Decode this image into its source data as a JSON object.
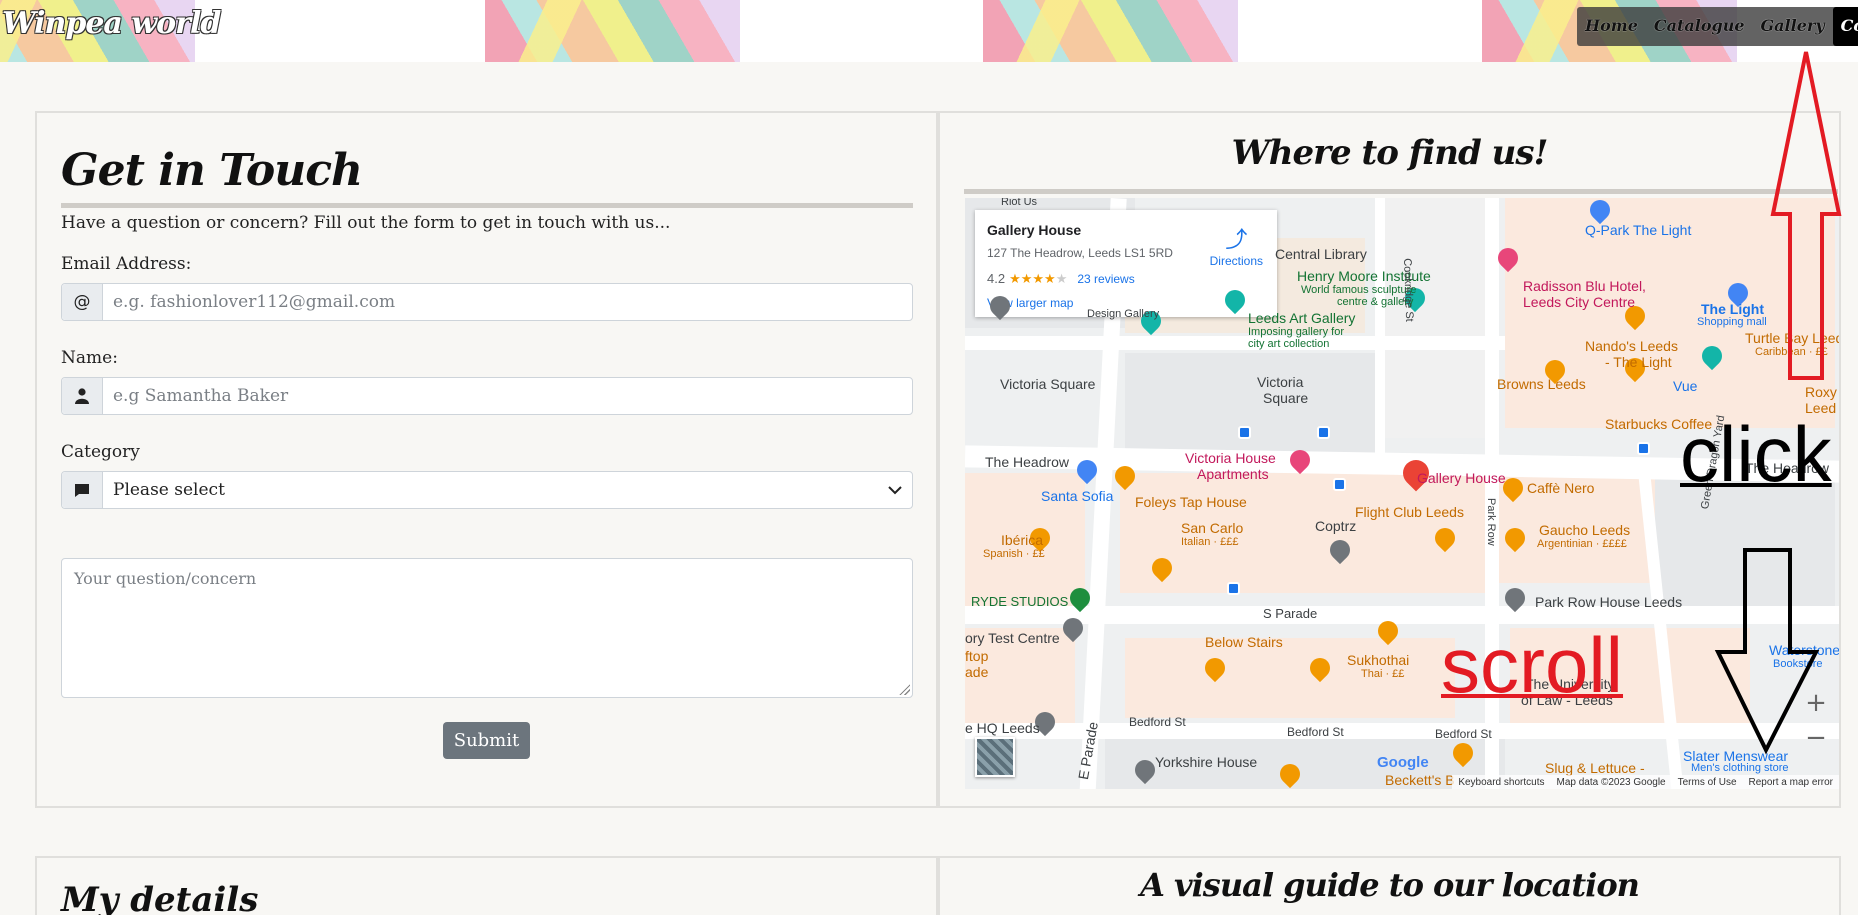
{
  "header": {
    "brand": "Winpea world",
    "nav": [
      {
        "label": "Home"
      },
      {
        "label": "Catalogue"
      },
      {
        "label": "Gallery"
      },
      {
        "label": "Contact U"
      }
    ]
  },
  "form": {
    "title": "Get in Touch",
    "lead": "Have a question or concern? Fill out the form to get in touch with us...",
    "email_label": "Email Address:",
    "email_addon": "@",
    "email_placeholder": "e.g. fashionlover112@gmail.com",
    "name_label": "Name:",
    "name_placeholder": "e.g Samantha Baker",
    "category_label": "Category",
    "category_selected": "Please select",
    "message_placeholder": "Your question/concern",
    "submit_label": "Submit"
  },
  "map_section": {
    "title": "Where to find us!",
    "card": {
      "name": "Gallery House",
      "address": "127 The Headrow, Leeds LS1 5RD",
      "rating": "4.2",
      "stars": "★★★★",
      "star_empty": "★",
      "reviews": "23 reviews",
      "larger": "View larger map",
      "directions": "Directions"
    },
    "labels": {
      "riot": "Riot Us",
      "library": "Central Library",
      "henry_moore": "Henry Moore Institute",
      "henry_moore_sub1": "World famous sculpture",
      "henry_moore_sub2": "centre & gallery",
      "leeds_art": "Leeds Art Gallery",
      "leeds_art_sub1": "Imposing gallery for",
      "leeds_art_sub2": "city art collection",
      "design_gallery": "Design Gallery",
      "radisson": "Radisson Blu Hotel,",
      "radisson2": "Leeds City Centre",
      "qpark": "Q-Park The Light",
      "the_light": "The Light",
      "the_light_sub": "Shopping mall",
      "turtle_bay": "Turtle Bay Leeds",
      "turtle_bay_sub": "Caribbean · ££",
      "nandos": "Nando's Leeds",
      "nandos2": "- The Light",
      "browns": "Browns Leeds",
      "vue": "Vue",
      "roxy": "Roxy",
      "roxy2": "Leed",
      "starbucks": "Starbucks Coffee",
      "victoria_sq_street": "Victoria Square",
      "victoria_sq": "Victoria",
      "victoria_sq2": "Square",
      "cookridge": "Cookridge St",
      "headrow": "The Headrow",
      "headrow2": "The Headrow",
      "victoria_house": "Victoria House",
      "victoria_house2": "Apartments",
      "gallery_house": "Gallery House",
      "caffe_nero": "Caffè Nero",
      "santa_sofia": "Santa Sofia",
      "foleys": "Foleys Tap House",
      "flight_club": "Flight Club Leeds",
      "coptrz": "Coptrz",
      "gaucho": "Gaucho Leeds",
      "gaucho_sub": "Argentinian · ££££",
      "iberica": "Ibérica",
      "iberica_sub": "Spanish · ££",
      "san_carlo": "San Carlo",
      "san_carlo_sub": "Italian · £££",
      "park_row": "Park Row",
      "ryde": "RYDE STUDIOS",
      "park_row_house": "Park Row House Leeds",
      "green_dragon": "Green Dragon Yard",
      "s_parade": "S Parade",
      "victory": "ory Test Centre",
      "rooftop": "ftop",
      "rooftop2": "ade",
      "below_stairs": "Below Stairs",
      "sukhothai": "Sukhothai",
      "sukhothai_sub": "Thai · ££",
      "univ": "The University",
      "univ2": "of Law - Leeds",
      "waterstones": "Waterstones (",
      "waterstones_sub": "Bookstore",
      "hq": "e HQ Leeds",
      "bedford": "Bedford St",
      "bedford2": "Bedford St",
      "bedford3": "Bedford St",
      "e_parade": "E Parade",
      "yorkshire": "Yorkshire House",
      "slater": "Slater Menswear",
      "slater_sub": "Men's clothing store",
      "slug": "Slug & Lettuce -",
      "becketts": "Beckett's B",
      "google": "Google"
    },
    "attribution": [
      "Keyboard shortcuts",
      "Map data ©2023 Google",
      "Terms of Use",
      "Report a map error"
    ],
    "zoom_in": "+",
    "zoom_out": "−"
  },
  "annotations": {
    "click": "click",
    "scroll": "scroll"
  },
  "details": {
    "title": "My details"
  },
  "guide": {
    "title": "A visual guide to our location"
  }
}
